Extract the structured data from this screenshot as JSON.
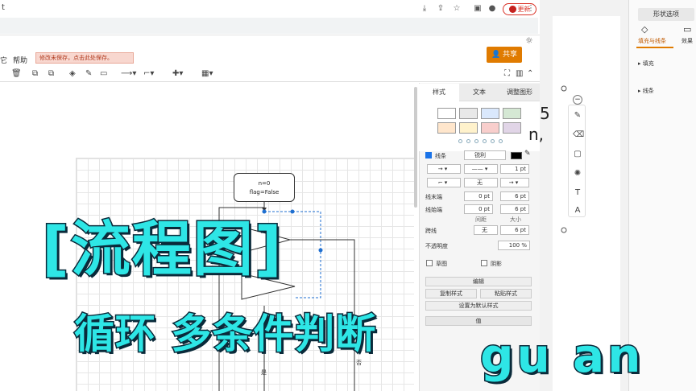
{
  "browser": {
    "tab_text": "t",
    "update_label": "更新"
  },
  "menubar": {
    "prev_item": "它",
    "help": "帮助",
    "unsaved_notice": "修改未保存，点击此处保存。",
    "share": "共享"
  },
  "canvas": {
    "node_n0_line1": "n=0",
    "node_n0_line2": "flag=False",
    "edge_label_yes": "是",
    "edge_label_no": "否"
  },
  "format_panel": {
    "tabs": [
      "样式",
      "文本",
      "调整图形"
    ],
    "swatch_colors": [
      "#ffffff",
      "#e8e8e8",
      "#dae8fc",
      "#d5e8d4",
      "#ffe6cc",
      "#fff2cc",
      "#f8cecc",
      "#e1d5e7"
    ],
    "line_label": "线条",
    "line_style": "锐利",
    "line_color": "#000000",
    "line_width": "1 pt",
    "waypoint_none": "无",
    "line_end_label": "线末端",
    "line_end_value": "0 pt",
    "line_end_size": "6 pt",
    "line_start_label": "线始端",
    "line_start_value": "0 pt",
    "line_start_size": "6 pt",
    "spacing_label": "间距",
    "size_label": "大小",
    "jump_label": "跨线",
    "jump_value": "无",
    "jump_size": "6 pt",
    "opacity_label": "不透明度",
    "opacity_value": "100 %",
    "sketch_label": "草图",
    "shadow_label": "阴影",
    "edit_label": "编辑",
    "copy_style": "复制样式",
    "paste_style": "粘贴样式",
    "set_default": "设置为默认样式",
    "value_label": "值"
  },
  "right_side": {
    "doc_text_line1": "5",
    "doc_text_line2": "n,",
    "sidebar_tab": "形状选项",
    "sidebar_sub1": "填充与线条",
    "sidebar_sub2": "效果",
    "fill_label": "填充",
    "line_label": "线条"
  },
  "overlay": {
    "title": "[流程图]",
    "subtitle": "循环 多条件判断",
    "signature": "gu an"
  }
}
